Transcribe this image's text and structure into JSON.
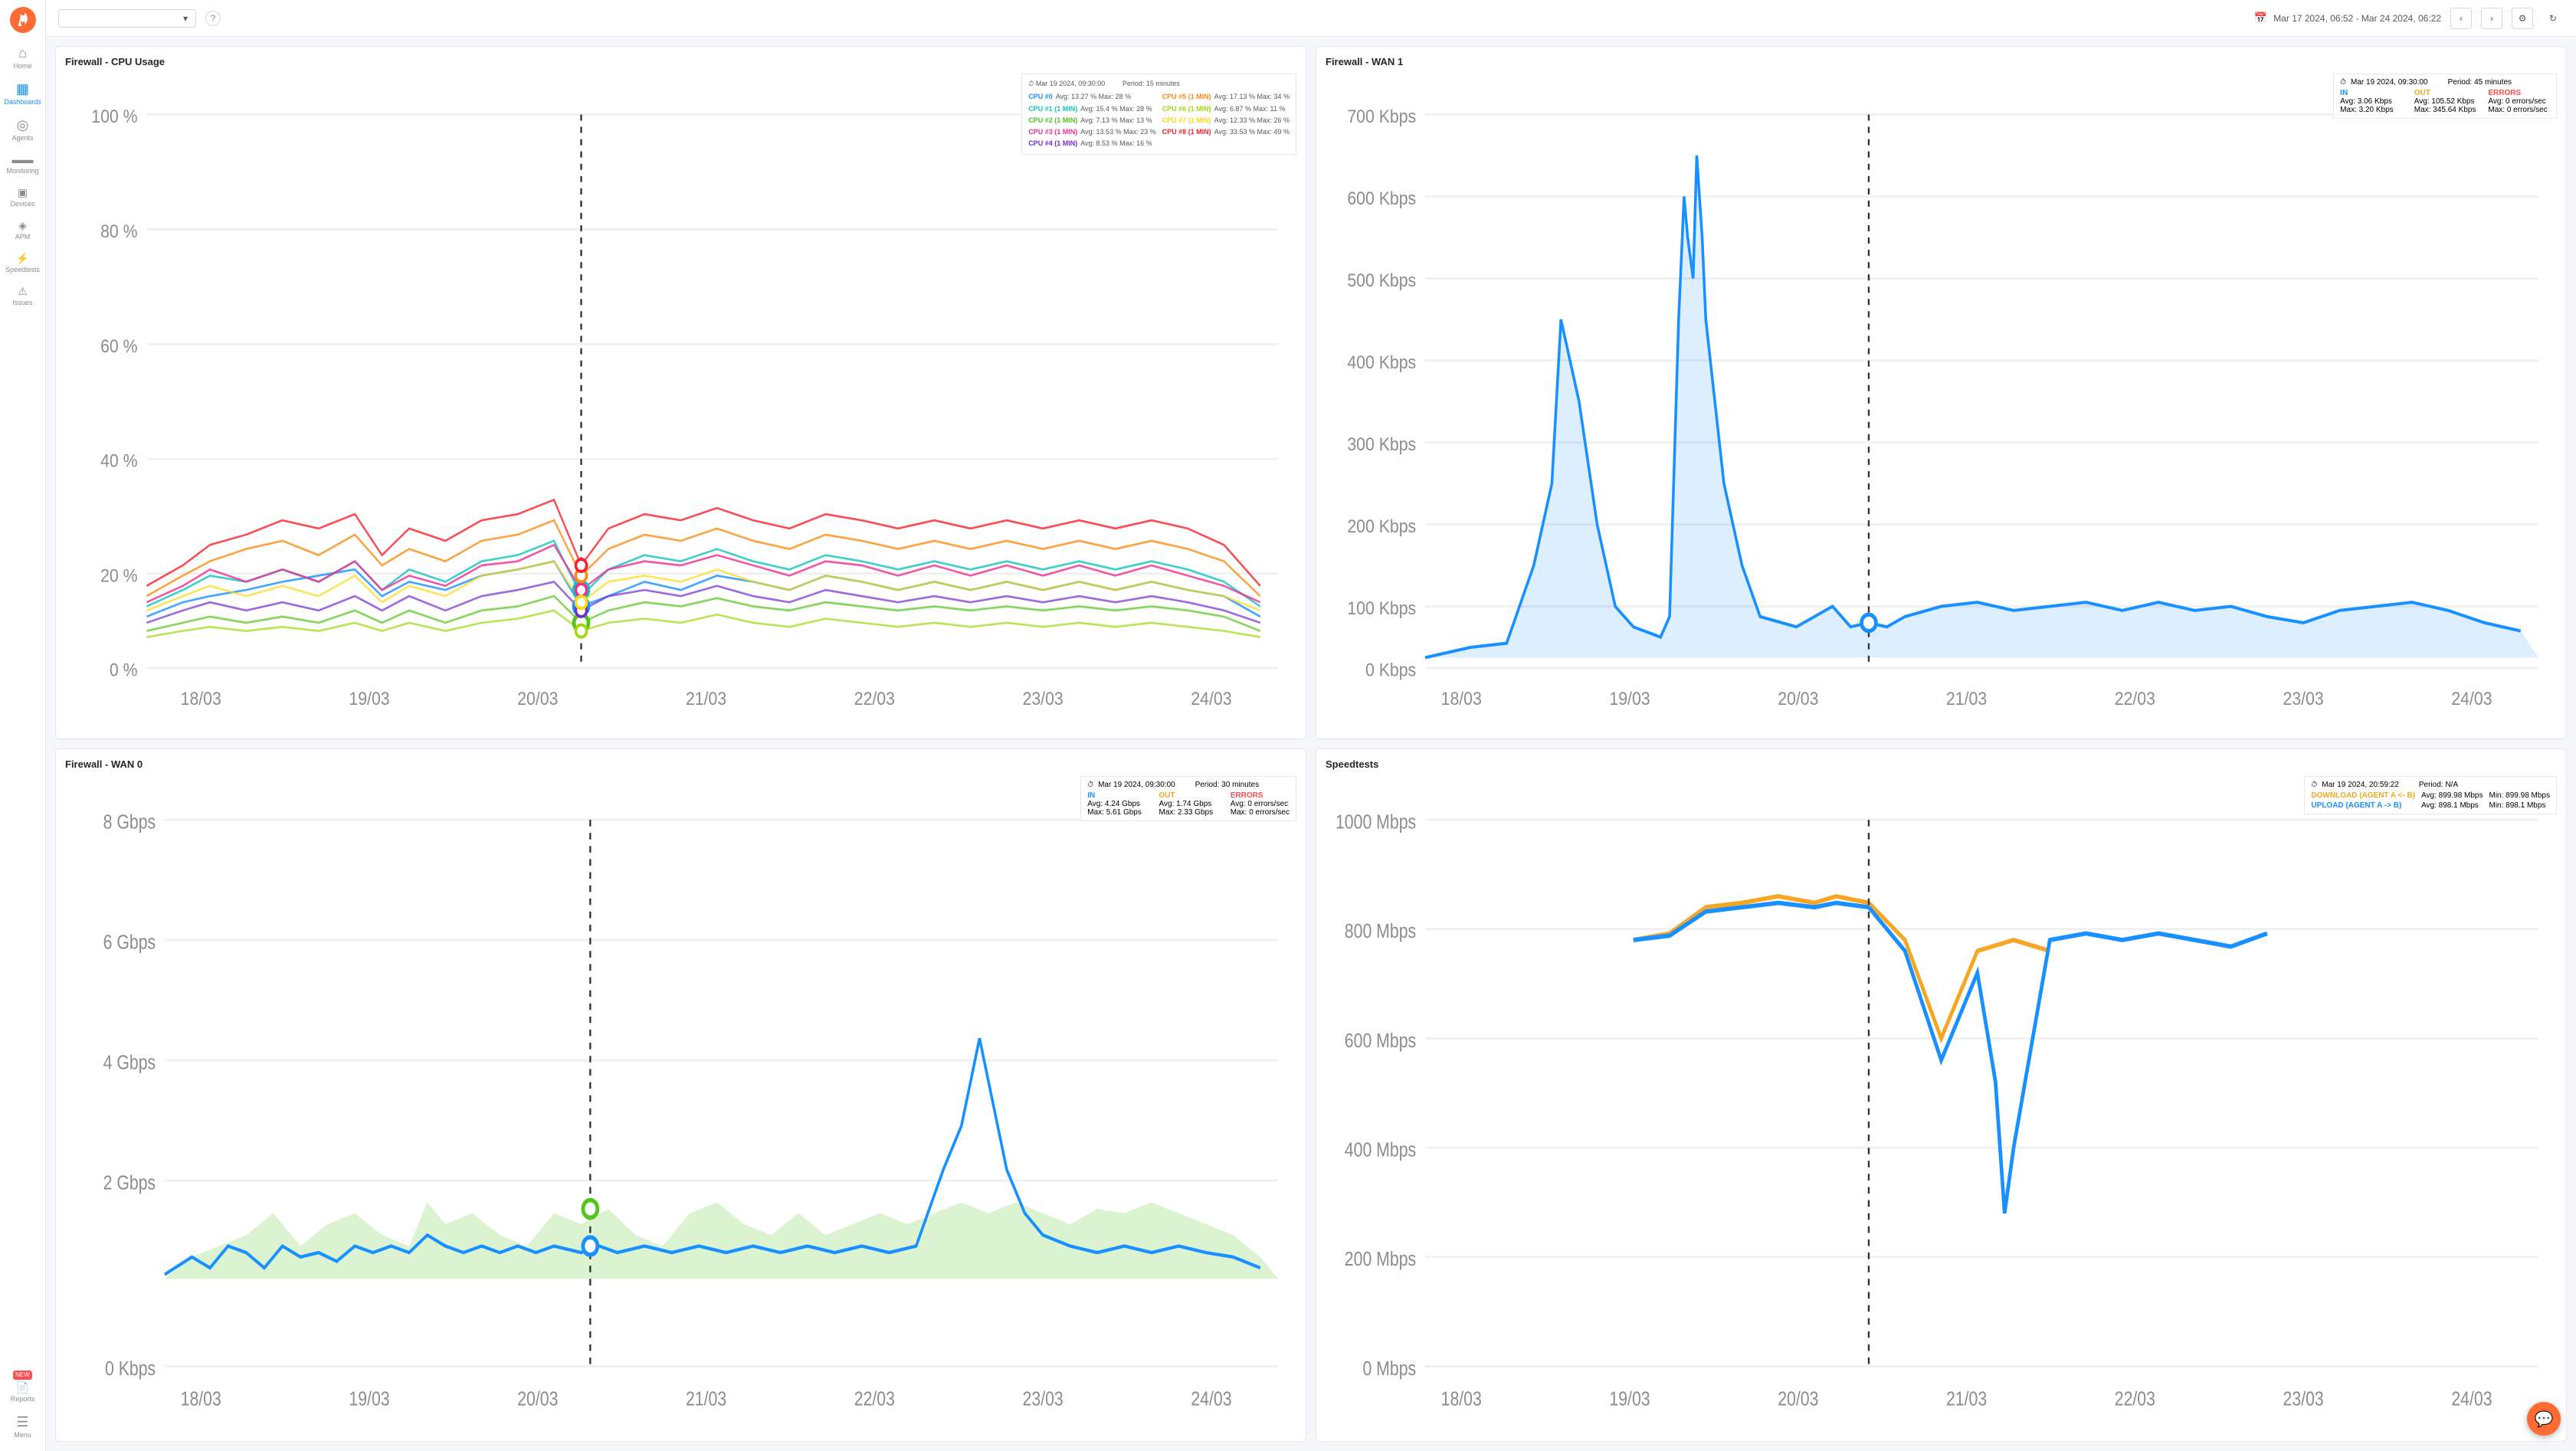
{
  "sidebar": {
    "logo_icon": "🔥",
    "items": [
      {
        "id": "home",
        "label": "Home",
        "icon": "⊞",
        "active": false
      },
      {
        "id": "dashboards",
        "label": "Dashboards",
        "icon": "▦",
        "active": true
      },
      {
        "id": "agents",
        "label": "Agents",
        "icon": "◎",
        "active": false
      },
      {
        "id": "monitoring",
        "label": "Monitoring",
        "icon": "📊",
        "active": false
      },
      {
        "id": "devices",
        "label": "Devices",
        "icon": "🖥",
        "active": false
      },
      {
        "id": "apm",
        "label": "APM",
        "icon": "◈",
        "active": false
      },
      {
        "id": "speedtests",
        "label": "Speedtests",
        "icon": "⚡",
        "active": false
      },
      {
        "id": "issues",
        "label": "Issues",
        "icon": "⚠",
        "active": false
      },
      {
        "id": "reports",
        "label": "Reports",
        "icon": "📄",
        "active": false
      }
    ],
    "menu_label": "Menu"
  },
  "header": {
    "selector_placeholder": "",
    "help_title": "?",
    "date_range": "Mar 17 2024, 06:52 - Mar 24 2024, 06:22"
  },
  "panels": {
    "cpu": {
      "title": "Firewall - CPU Usage",
      "tooltip_time": "Mar 19 2024, 09:30:00",
      "tooltip_period": "Period: 15 minutes",
      "y_axis": [
        "100 %",
        "80 %",
        "60 %",
        "40 %",
        "20 %",
        "0 %"
      ],
      "x_axis": [
        "18/03",
        "19/03",
        "20/03",
        "21/03",
        "22/03",
        "23/03",
        "24/03"
      ],
      "series": [
        {
          "name": "CPU #0",
          "color": "#1890ff",
          "avg": "13.27 %",
          "max": "28 %"
        },
        {
          "name": "CPU #1 (1 MIN)",
          "color": "#13c2c2",
          "avg": "15.4 %",
          "max": "28 %"
        },
        {
          "name": "CPU #2 (1 MIN)",
          "color": "#52c41a",
          "avg": "7.13 %",
          "max": "13 %"
        },
        {
          "name": "CPU #3 (1 MIN)",
          "color": "#eb2f96",
          "avg": "13.53 %",
          "max": "23 %"
        },
        {
          "name": "CPU #4 (1 MIN)",
          "color": "#722ed1",
          "avg": "8.53 %",
          "max": "16 %"
        },
        {
          "name": "CPU #5 (1 MIN)",
          "color": "#fa8c16",
          "avg": "17.13 %",
          "max": "34 %"
        },
        {
          "name": "CPU #6 (1 MIN)",
          "color": "#a0d911",
          "avg": "6.87 %",
          "max": "11 %"
        },
        {
          "name": "CPU #7 (1 MIN)",
          "color": "#fadb14",
          "avg": "12.33 %",
          "max": "26 %"
        },
        {
          "name": "CPU #8 (1 MIN)",
          "color": "#f5222d",
          "avg": "33.53 %",
          "max": "49 %"
        }
      ]
    },
    "wan1": {
      "title": "Firewall - WAN 1",
      "tooltip_time": "Mar 19 2024, 09:30:00",
      "tooltip_period": "Period: 45 minutes",
      "y_axis": [
        "700 Kbps",
        "600 Kbps",
        "500 Kbps",
        "400 Kbps",
        "300 Kbps",
        "200 Kbps",
        "100 Kbps",
        "0 Kbps"
      ],
      "x_axis": [
        "18/03",
        "19/03",
        "20/03",
        "21/03",
        "22/03",
        "23/03",
        "24/03"
      ],
      "in_label": "IN",
      "out_label": "OUT",
      "errors_label": "ERRORS",
      "in_avg": "Avg: 3.06 Kbps",
      "in_max": "Max: 3.20 Kbps",
      "out_avg": "Avg: 105.52 Kbps",
      "out_max": "Max: 345.64 Kbps",
      "err_avg": "Avg: 0 errors/sec",
      "err_max": "Max: 0 errors/sec"
    },
    "wan0": {
      "title": "Firewall - WAN 0",
      "tooltip_time": "Mar 19 2024, 09:30:00",
      "tooltip_period": "Period: 30 minutes",
      "y_axis": [
        "8 Gbps",
        "6 Gbps",
        "4 Gbps",
        "2 Gbps",
        "0 Kbps"
      ],
      "x_axis": [
        "18/03",
        "19/03",
        "20/03",
        "21/03",
        "22/03",
        "23/03",
        "24/03"
      ],
      "in_label": "IN",
      "out_label": "OUT",
      "errors_label": "ERRORS",
      "in_avg": "Avg: 4.24 Gbps",
      "in_max": "Max: 5.61 Gbps",
      "out_avg": "Avg: 1.74 Gbps",
      "out_max": "Max: 2.33 Gbps",
      "err_avg": "Avg: 0 errors/sec",
      "err_max": "Max: 0 errors/sec"
    },
    "speedtests": {
      "title": "Speedtests",
      "tooltip_time": "Mar 19 2024, 20:59:22",
      "tooltip_period": "Period: N/A",
      "y_axis": [
        "1000 Mbps",
        "800 Mbps",
        "600 Mbps",
        "400 Mbps",
        "200 Mbps",
        "0 Mbps"
      ],
      "x_axis": [
        "18/03",
        "19/03",
        "20/03",
        "21/03",
        "22/03",
        "23/03",
        "24/03"
      ],
      "dl_label": "DOWNLOAD (AGENT A <- B)",
      "dl_avg": "Avg: 899.98 Mbps",
      "dl_min": "Min: 899.98 Mbps",
      "ul_label": "UPLOAD (AGENT A -> B)",
      "ul_avg": "Avg: 898.1 Mbps",
      "ul_min": "Min: 898.1 Mbps"
    }
  }
}
